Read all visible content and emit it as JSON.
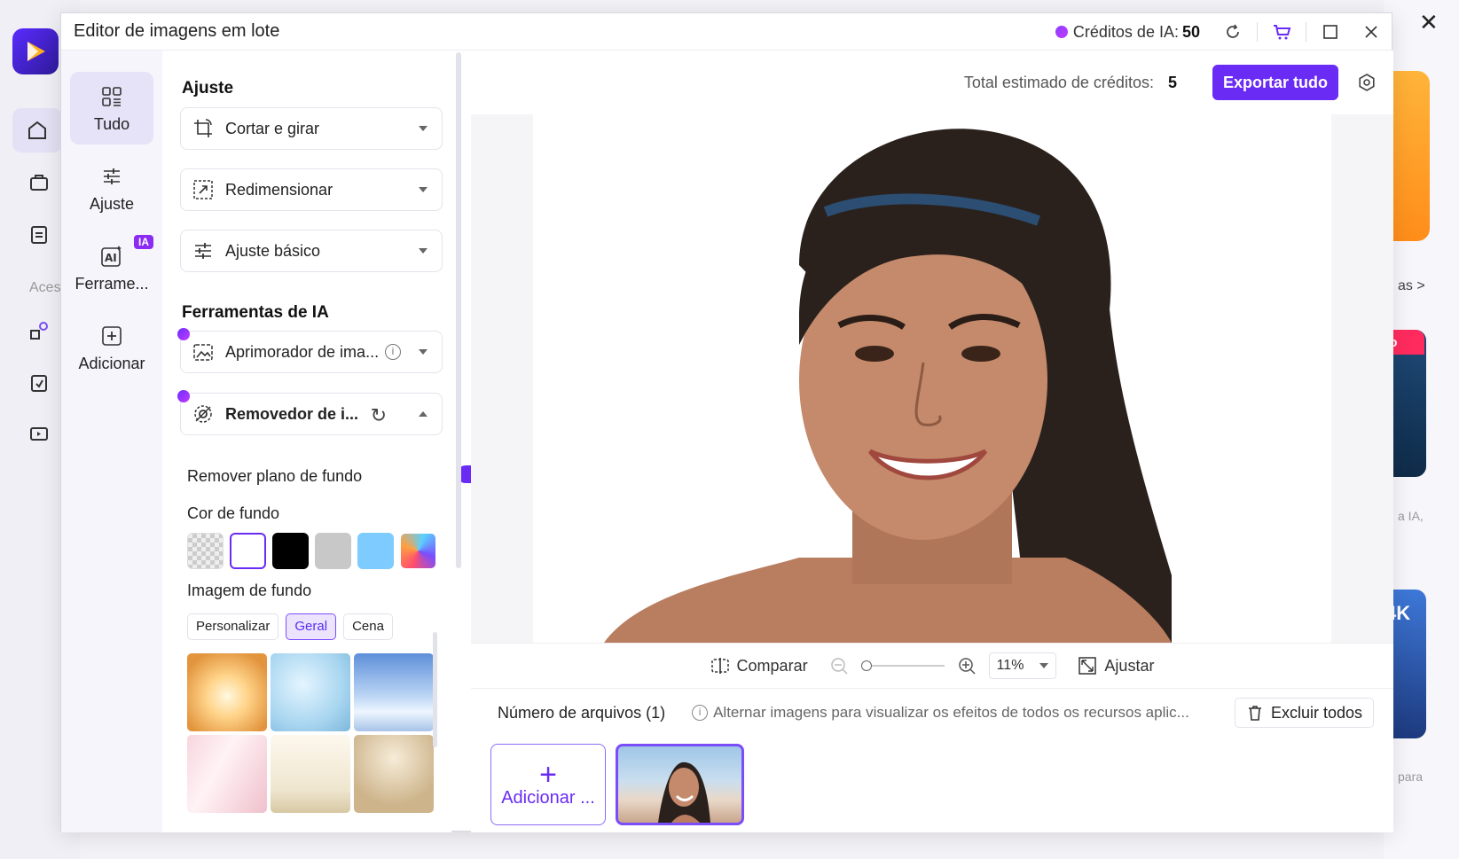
{
  "window": {
    "title": "Editor de imagens em lote",
    "credits_label": "Créditos de IA:",
    "credits_value": "50"
  },
  "background_app": {
    "rail_label": "Aces",
    "right_fragments": [
      "as >",
      "vo",
      "a IA,",
      "4K",
      "para"
    ]
  },
  "nav": {
    "items": [
      {
        "label": "Tudo",
        "icon": "grid-icon",
        "active": true
      },
      {
        "label": "Ajuste",
        "icon": "sliders-icon"
      },
      {
        "label": "Ferrame...",
        "icon": "ai-icon",
        "badge": "IA"
      },
      {
        "label": "Adicionar",
        "icon": "plus-box-icon"
      }
    ]
  },
  "panel": {
    "adjust_title": "Ajuste",
    "adjust_items": [
      {
        "label": "Cortar e girar",
        "icon": "crop-rotate-icon"
      },
      {
        "label": "Redimensionar",
        "icon": "resize-icon"
      },
      {
        "label": "Ajuste básico",
        "icon": "basic-adjust-icon"
      }
    ],
    "ai_title": "Ferramentas de IA",
    "ai_items": [
      {
        "label": "Aprimorador de ima...",
        "icon": "enhance-icon"
      },
      {
        "label": "Removedor de i...",
        "icon": "remover-icon",
        "expanded": true
      }
    ],
    "remove_bg_label": "Remover plano de fundo",
    "remove_bg_on": true,
    "bg_color_label": "Cor de fundo",
    "bg_colors": [
      "transparent",
      "#ffffff",
      "#000000",
      "#c8c8c8",
      "#7ecbff",
      "gradient"
    ],
    "bg_image_label": "Imagem de fundo",
    "bg_image_tabs": [
      {
        "label": "Personalizar"
      },
      {
        "label": "Geral",
        "active": true
      },
      {
        "label": "Cena"
      }
    ]
  },
  "preview": {
    "total_label": "Total estimado de créditos:",
    "total_value": "5",
    "export_label": "Exportar tudo",
    "compare_label": "Comparar",
    "zoom_value": "11%",
    "fit_label": "Ajustar"
  },
  "files": {
    "count_label": "Número de arquivos (1)",
    "hint": "Alternar imagens para visualizar os efeitos de todos os recursos aplic...",
    "delete_all_label": "Excluir todos",
    "add_label": "Adicionar ..."
  }
}
